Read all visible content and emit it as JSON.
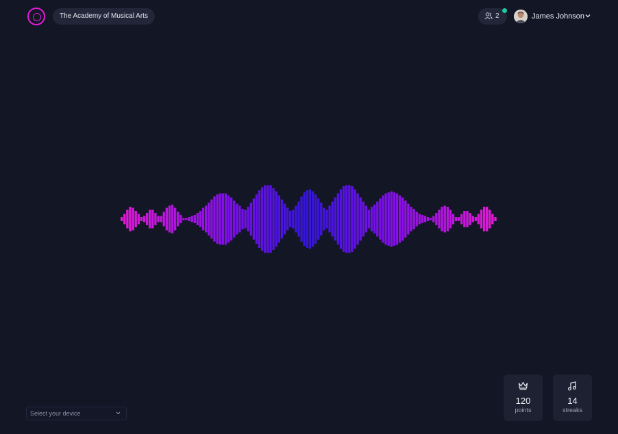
{
  "header": {
    "org_name": "The Academy of Musical Arts",
    "users_count": "2",
    "user_name": "James Johnson",
    "online_status_color": "#1dc8a3",
    "logo_icon": "ring-logo-icon"
  },
  "visualizer": {
    "gradient": [
      "#e21bd4",
      "#8110e8",
      "#3415db"
    ]
  },
  "stats": [
    {
      "icon": "crown-icon",
      "value": "120",
      "label": "points"
    },
    {
      "icon": "music-note-icon",
      "value": "14",
      "label": "streaks"
    }
  ],
  "device_select": {
    "placeholder": "Select your device"
  }
}
